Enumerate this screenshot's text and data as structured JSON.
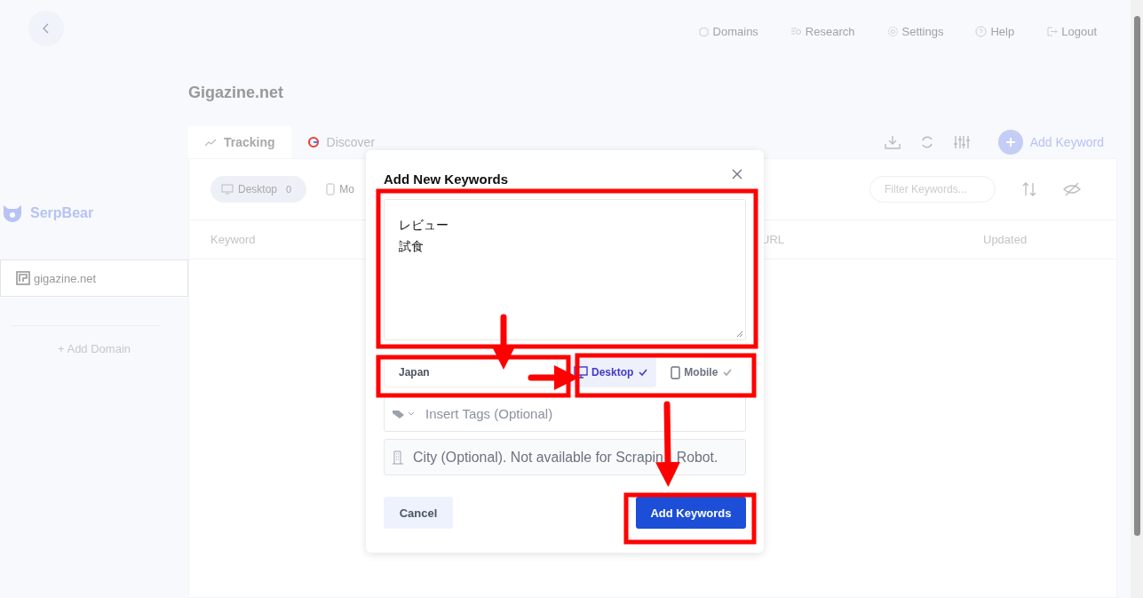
{
  "topnav": [
    {
      "label": "Domains",
      "kind": "domains"
    },
    {
      "label": "Research",
      "kind": "research"
    },
    {
      "label": "Settings",
      "kind": "settings"
    },
    {
      "label": "Help",
      "kind": "help"
    },
    {
      "label": "Logout",
      "kind": "logout"
    }
  ],
  "sidebar": {
    "brand": "SerpBear",
    "domains": [
      {
        "label": "gigazine.net",
        "selected": true
      }
    ],
    "add_domain": "+ Add Domain"
  },
  "domain_title": "Gigazine.net",
  "tabs": [
    {
      "label": "Tracking",
      "kind": "tracking",
      "selected": true
    },
    {
      "label": "Discover",
      "kind": "google",
      "selected": false
    }
  ],
  "add_keyword": "Add Keyword",
  "filters": {
    "devices": [
      {
        "label": "Desktop",
        "kind": "desktop",
        "count": "0",
        "selected": true
      },
      {
        "label": "Mo",
        "kind": "mobile",
        "selected": false
      }
    ],
    "search_placeholder": "Filter Keywords..."
  },
  "table": {
    "columns": [
      "Keyword",
      "URL",
      "Updated"
    ]
  },
  "modal": {
    "title": "Add New Keywords",
    "keywords": [
      "レビュー",
      "試食"
    ],
    "country": "Japan",
    "devices": [
      {
        "label": "Desktop",
        "kind": "desktop",
        "selected": true
      },
      {
        "label": "Mobile",
        "kind": "mobile",
        "selected": false
      }
    ],
    "tags_placeholder": "Insert Tags (Optional)",
    "city_placeholder": [
      "City (Optional). Not available for Scrapin",
      "Robot."
    ],
    "cancel": "Cancel",
    "submit": "Add Keywords"
  }
}
